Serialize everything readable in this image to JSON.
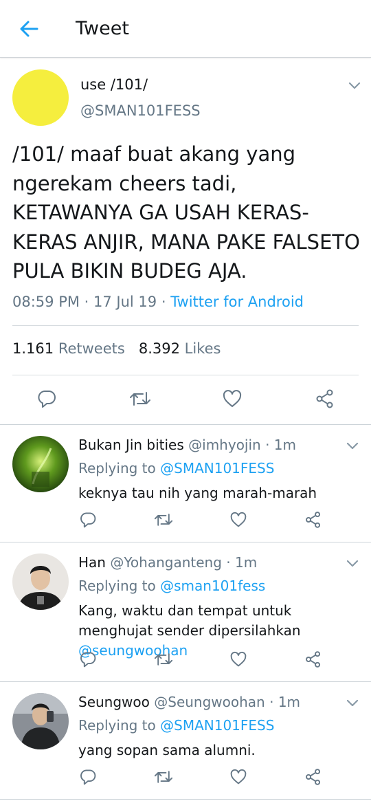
{
  "header": {
    "title": "Tweet"
  },
  "tweet": {
    "name": "use /101/",
    "handle": "@SMAN101FESS",
    "text": "/101/ maaf buat akang yang ngerekam cheers tadi, KETAWANYA GA USAH KERAS-KERAS ANJIR, MANA PAKE FALSETO PULA BIKIN BUDEG AJA.",
    "time": "08:59 PM",
    "date": "17 Jul 19",
    "source": "Twitter for Android",
    "retweets": "1.161",
    "retweets_label": "Retweets",
    "likes": "8.392",
    "likes_label": "Likes",
    "avatar_color": "#f5ee3e"
  },
  "replies": [
    {
      "name": "Bukan Jin bities",
      "handle": "@imhyojin",
      "time": "1m",
      "replying_label": "Replying to",
      "replying_to": "@SMAN101FESS",
      "text": "keknya tau nih yang marah-marah",
      "mention": ""
    },
    {
      "name": "Han",
      "handle": "@Yohanganteng",
      "time": "1m",
      "replying_label": "Replying to",
      "replying_to": "@sman101fess",
      "text": "Kang, waktu dan tempat untuk menghujat sender dipersilahkan",
      "mention": "@seungwoohan"
    },
    {
      "name": "Seungwoo",
      "handle": "@Seungwoohan",
      "time": "1m",
      "replying_label": "Replying to",
      "replying_to": "@SMAN101FESS",
      "text": "yang sopan sama alumni.",
      "mention": ""
    }
  ],
  "colors": {
    "accent": "#1da1f2",
    "secondary": "#657786",
    "text": "#14171a"
  },
  "icons": [
    "back-arrow-icon",
    "chevron-down-icon",
    "reply-icon",
    "retweet-icon",
    "like-icon",
    "share-icon"
  ]
}
